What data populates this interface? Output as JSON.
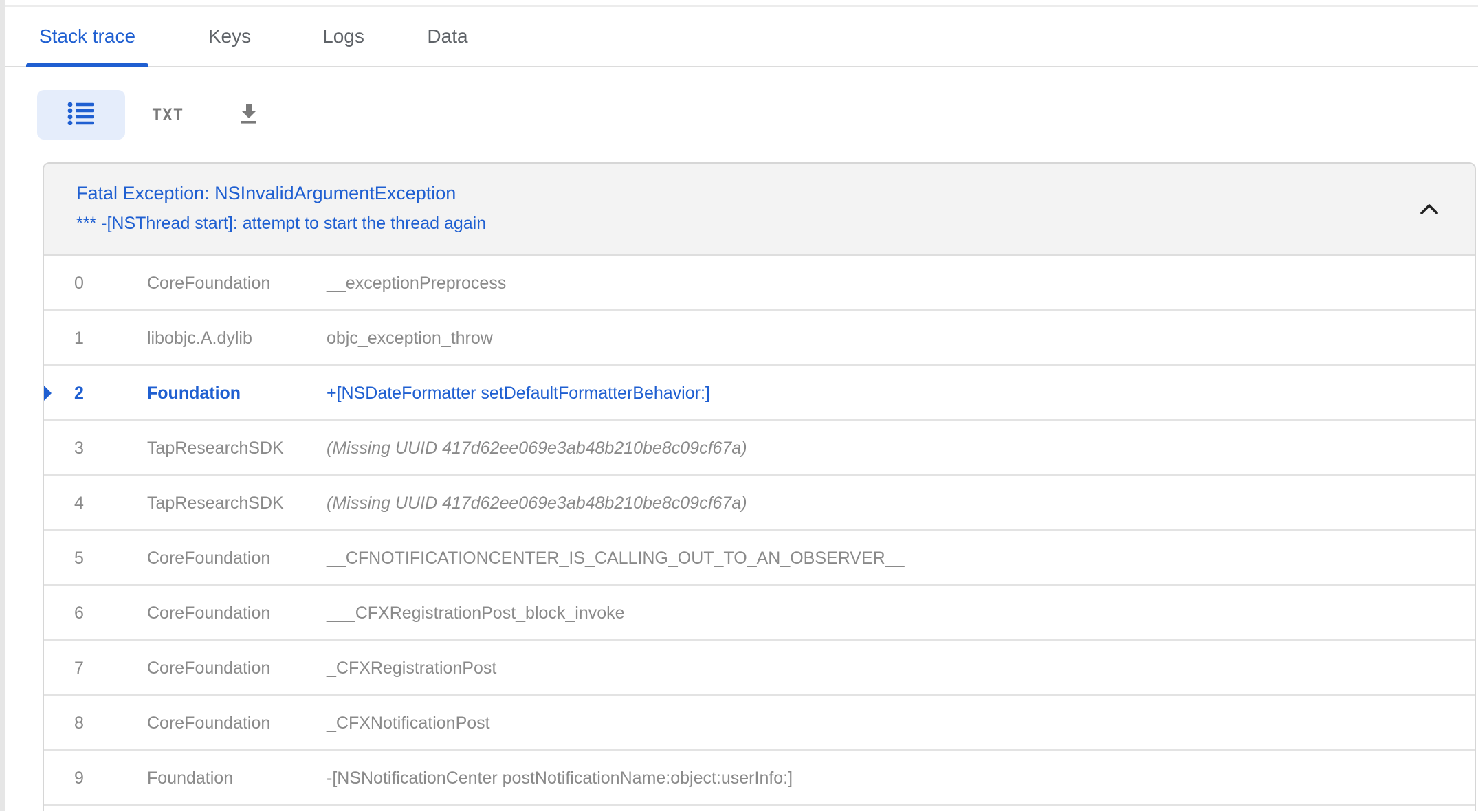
{
  "tabs": [
    {
      "label": "Stack trace",
      "active": true
    },
    {
      "label": "Keys",
      "active": false
    },
    {
      "label": "Logs",
      "active": false
    },
    {
      "label": "Data",
      "active": false
    }
  ],
  "toolbar": {
    "list_view": {
      "icon": "list-icon",
      "selected": true
    },
    "text_view": {
      "label": "TXT"
    },
    "download": {
      "icon": "download-icon"
    }
  },
  "exception": {
    "title": "Fatal Exception: NSInvalidArgumentException",
    "message": "*** -[NSThread start]: attempt to start the thread again",
    "collapse_icon": "chevron-up-icon"
  },
  "frames": [
    {
      "index": "0",
      "library": "CoreFoundation",
      "symbol": "__exceptionPreprocess"
    },
    {
      "index": "1",
      "library": "libobjc.A.dylib",
      "symbol": "objc_exception_throw"
    },
    {
      "index": "2",
      "library": "Foundation",
      "symbol": "+[NSDateFormatter setDefaultFormatterBehavior:]"
    },
    {
      "index": "3",
      "library": "TapResearchSDK",
      "symbol": "(Missing UUID 417d62ee069e3ab48b210be8c09cf67a)"
    },
    {
      "index": "4",
      "library": "TapResearchSDK",
      "symbol": "(Missing UUID 417d62ee069e3ab48b210be8c09cf67a)"
    },
    {
      "index": "5",
      "library": "CoreFoundation",
      "symbol": "__CFNOTIFICATIONCENTER_IS_CALLING_OUT_TO_AN_OBSERVER__"
    },
    {
      "index": "6",
      "library": "CoreFoundation",
      "symbol": "___CFXRegistrationPost_block_invoke"
    },
    {
      "index": "7",
      "library": "CoreFoundation",
      "symbol": "_CFXRegistrationPost"
    },
    {
      "index": "8",
      "library": "CoreFoundation",
      "symbol": "_CFXNotificationPost"
    },
    {
      "index": "9",
      "library": "Foundation",
      "symbol": "-[NSNotificationCenter postNotificationName:object:userInfo:]"
    }
  ],
  "colors": {
    "accent": "#1f5fd1",
    "selected_bg": "#e5edfb",
    "header_bg": "#f3f3f3",
    "muted_text": "#8a8a8a"
  }
}
